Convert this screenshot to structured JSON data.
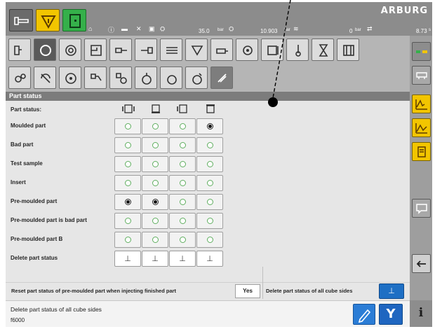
{
  "statusbar": {
    "brand": "ARBURG",
    "machine_icon": "machine-icon",
    "warning_icon": "warning-triangle-icon",
    "door_icon": "door-icon",
    "values": {
      "pressure": "35.0",
      "pressure_unit": "bar",
      "cylinder": "10.903",
      "cylinder_unit": "bar",
      "feed": "0",
      "feed_unit": "bar",
      "cycle": "8.73",
      "cycle_unit": "s"
    }
  },
  "section_title": "Part status",
  "part_status_label": "Part status:",
  "column_icons": [
    "cube-side-1-icon",
    "cube-side-2-icon",
    "cube-side-3-icon",
    "cube-side-4-icon"
  ],
  "rows": [
    {
      "label": "Moulded part",
      "selected": [
        false,
        false,
        false,
        true
      ]
    },
    {
      "label": "Bad part",
      "selected": [
        false,
        false,
        false,
        false
      ]
    },
    {
      "label": "Test sample",
      "selected": [
        false,
        false,
        false,
        false
      ]
    },
    {
      "label": "Insert",
      "selected": [
        false,
        false,
        false,
        false
      ]
    },
    {
      "label": "Pre-moulded part",
      "selected": [
        true,
        true,
        false,
        false
      ]
    },
    {
      "label": "Pre-moulded part is bad part",
      "selected": [
        false,
        false,
        false,
        false
      ]
    },
    {
      "label": "Pre-moulded part B",
      "selected": [
        false,
        false,
        false,
        false
      ]
    }
  ],
  "delete_row_label": "Delete part status",
  "delete_icon": "delete-status-icon",
  "reset_label": "Reset part status of pre-moulded part when injecting finished part",
  "reset_value": "Yes",
  "delete_all_label": "Delete part status of all cube sides",
  "footer": {
    "message": "Delete part status of all cube sides",
    "code": "f6000"
  },
  "buttons": {
    "y_label": "Y",
    "info_label": "i"
  },
  "colors": {
    "accent_yellow": "#f2c500",
    "accent_green": "#35b04a",
    "accent_blue": "#1f66c0",
    "radio_green": "#5fae5f"
  }
}
